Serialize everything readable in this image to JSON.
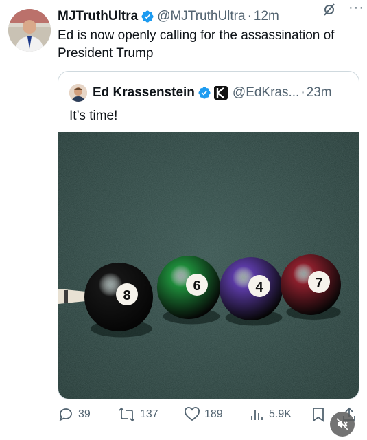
{
  "tweet": {
    "author": {
      "display_name": "MJTruthUltra",
      "handle": "@MJTruthUltra",
      "time": "12m",
      "verified": true
    },
    "text": "Ed is now openly calling for the assassination of President Trump",
    "quoted": {
      "display_name": "Ed Krassenstein",
      "handle": "@EdKras...",
      "time": "23m",
      "verified": true,
      "text": "It’s time!",
      "media": {
        "balls": [
          "8",
          "6",
          "4",
          "7"
        ],
        "ball_colors": [
          "#151515",
          "#1e8a3a",
          "#5a3aa3",
          "#8a1f2c"
        ],
        "felt_color": "#2f4744"
      }
    },
    "stats": {
      "replies": "39",
      "reposts": "137",
      "likes": "189",
      "views": "5.9K"
    },
    "separator": "·",
    "more_label": "···"
  },
  "icons": {
    "verified": "verified-badge-icon",
    "grok": "grok-icon",
    "more": "more-icon",
    "reply": "reply-icon",
    "repost": "repost-icon",
    "like": "like-icon",
    "views": "views-icon",
    "bookmark": "bookmark-icon",
    "share": "share-icon",
    "mute": "mute-icon"
  },
  "colors": {
    "accent": "#1d9bf0",
    "text": "#0f1419",
    "muted": "#536471"
  }
}
